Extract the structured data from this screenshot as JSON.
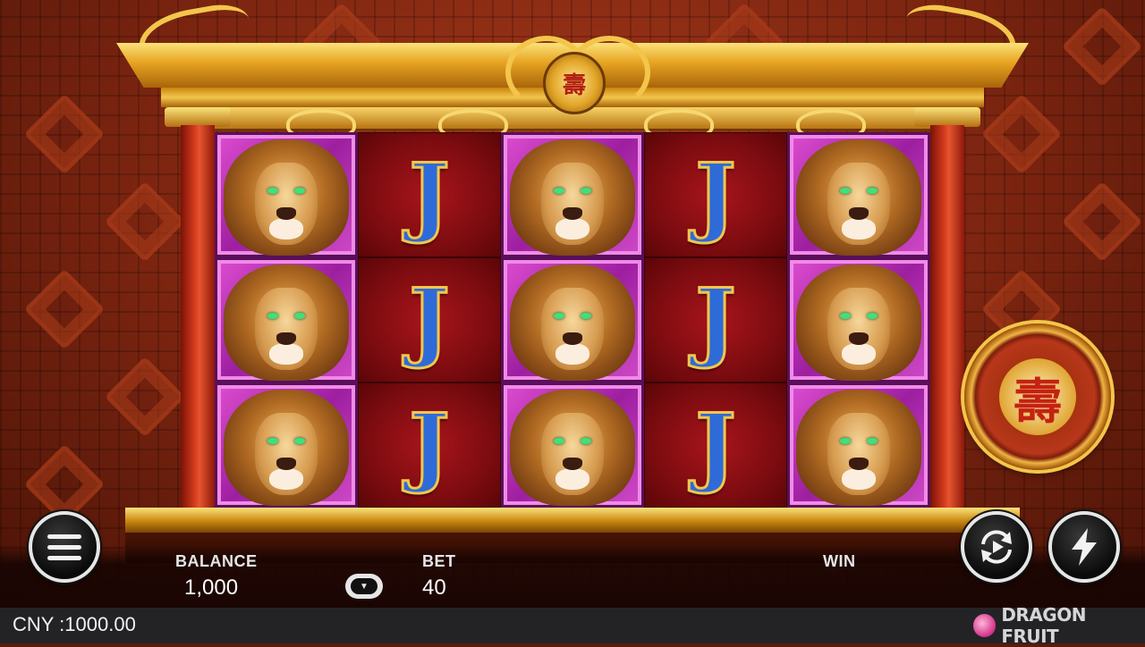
{
  "game": {
    "brand": "DRAGON FRUIT",
    "spin_symbol": "壽"
  },
  "reels": {
    "columns": [
      [
        "lion",
        "lion",
        "lion"
      ],
      [
        "J",
        "J",
        "J"
      ],
      [
        "lion",
        "lion",
        "lion"
      ],
      [
        "J",
        "J",
        "J"
      ],
      [
        "lion",
        "lion",
        "lion"
      ]
    ],
    "j_glyph": "J"
  },
  "hud": {
    "balance_label": "BALANCE",
    "balance_value": "1,000",
    "bet_label": "BET",
    "bet_value": "40",
    "win_label": "WIN",
    "bet_toggle_glyph": "▼"
  },
  "status": {
    "currency_text": "CNY :1000.00"
  },
  "icons": {
    "menu": "menu-icon",
    "autoplay": "autoplay-icon",
    "turbo": "lightning-icon",
    "spin": "spin-icon"
  },
  "colors": {
    "lion_frame": "#d14bc8",
    "j_background": "#7d0c10",
    "gold": "#f3c64b",
    "status_bar": "#232326"
  }
}
